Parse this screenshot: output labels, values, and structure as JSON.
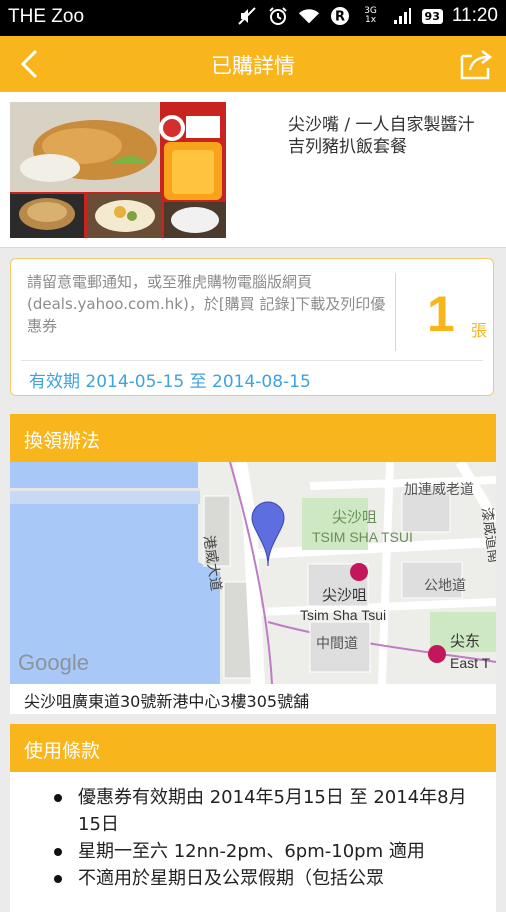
{
  "status_bar": {
    "app_name": "THE Zoo",
    "network_top": "3G",
    "network_bottom": "1x",
    "battery": "93",
    "time": "11:20"
  },
  "app_bar": {
    "title": "已購詳情"
  },
  "product": {
    "name": "尖沙嘴 / 一人自家製醬汁吉列豬扒飯套餐"
  },
  "voucher": {
    "notice": "請留意電郵通知，或至雅虎購物電腦版網頁(deals.yahoo.com.hk)，於[購買 記錄]下載及列印優惠券",
    "quantity": "1",
    "unit": "張",
    "validity": "有效期 2014-05-15 至 2014-08-15"
  },
  "redeem": {
    "header": "換領辦法",
    "address": "尖沙咀廣東道30號新港中心3樓305號舖",
    "map_labels": {
      "road_haiphong": "加連威老道",
      "district_cn": "尖沙咀",
      "district_en": "TSIM SHA TSUI",
      "station_cn": "尖沙咀",
      "station_en": "Tsim Sha Tsui",
      "canton_road": "港威大道",
      "kowloon_park": "公地道",
      "middle_road": "中間道",
      "east_cn": "尖东",
      "east_en": "East T",
      "chatham": "漆咸道南",
      "google": "Google"
    }
  },
  "terms": {
    "header": "使用條款",
    "items": [
      "優惠券有效期由 2014年5月15日 至 2014年8月15日",
      "星期一至六 12nn-2pm、6pm-10pm 適用",
      "不適用於星期日及公眾假期（包括公眾"
    ]
  },
  "colors": {
    "accent": "#f9b51c",
    "link": "#3fa2de",
    "map_water": "#a8c8f8",
    "map_park": "#cde8c2"
  }
}
